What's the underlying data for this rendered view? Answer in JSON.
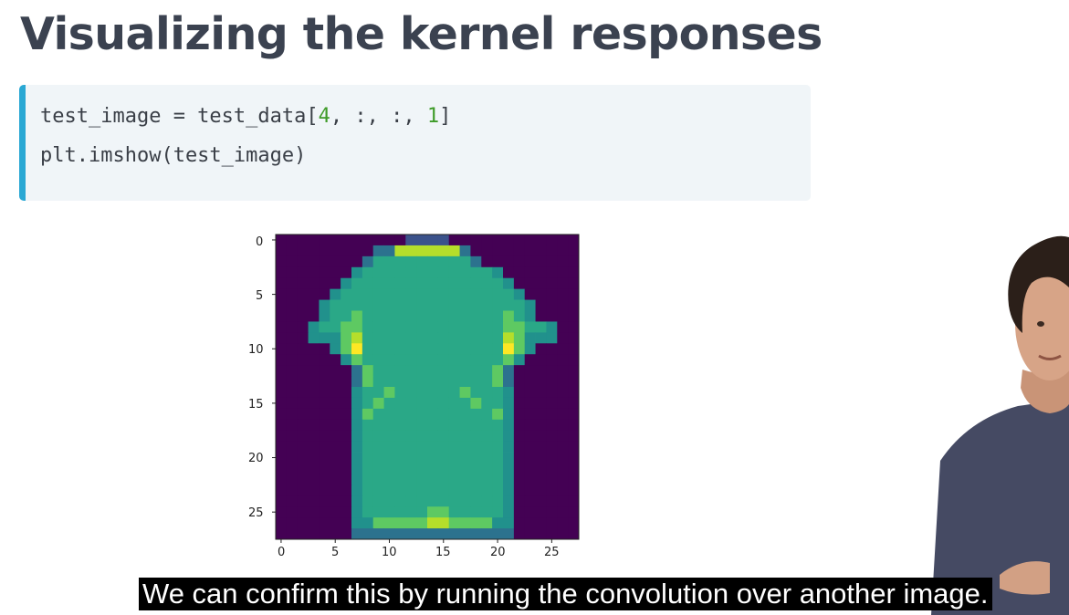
{
  "slide": {
    "title": "Visualizing the kernel responses"
  },
  "code": {
    "line1": {
      "parts": [
        "test_image = test_data[",
        "4",
        ", :, :, ",
        "1",
        "]"
      ]
    },
    "line2": "plt.imshow(test_image)"
  },
  "plot": {
    "y_ticks": [
      "0",
      "5",
      "10",
      "15",
      "20",
      "25"
    ],
    "x_ticks": [
      "0",
      "5",
      "10",
      "15",
      "20",
      "25"
    ]
  },
  "chart_data": {
    "type": "heatmap",
    "title": "",
    "xlabel": "",
    "ylabel": "",
    "xlim": [
      -0.5,
      27.5
    ],
    "ylim": [
      27.5,
      -0.5
    ],
    "x_ticks": [
      0,
      5,
      10,
      15,
      20,
      25
    ],
    "y_ticks": [
      0,
      5,
      10,
      15,
      20,
      25
    ],
    "colormap": "viridis",
    "grid": false,
    "rows": [
      "0000000000001111000000000000",
      "0000000002266666620000000000",
      "0000000024444444442000000000",
      "0000000344444444444430000000",
      "0000003444444444444443000000",
      "0000034444444444444444300000",
      "0000344444444444444444430000",
      "0000344544444444444445430000",
      "0003445544444444444445544300",
      "0003335644444444444446533300",
      "0000035744444444444447530000",
      "0000003544444444444445300000",
      "0000000254444444444452000000",
      "0000000254444444444452000000",
      "0000000344544444454443000000",
      "0000000345444444445443000000",
      "0000000354444444444453000000",
      "0000000344444444444443000000",
      "0000000344444444444443000000",
      "0000000344444444444443000000",
      "0000000344444444444443000000",
      "0000000344444444444443000000",
      "0000000344444444444443000000",
      "0000000344444444444443000000",
      "0000000344444444444443000000",
      "0000000344444455444443000000",
      "0000000335555566555533000000",
      "0000000222222222222222000000"
    ],
    "palette": [
      "#440154",
      "#3b528b",
      "#2c728e",
      "#21918c",
      "#2aa887",
      "#5ec962",
      "#b5de2b",
      "#fde725"
    ]
  },
  "video": {
    "caption": "We can confirm this by running the convolution over another image."
  }
}
